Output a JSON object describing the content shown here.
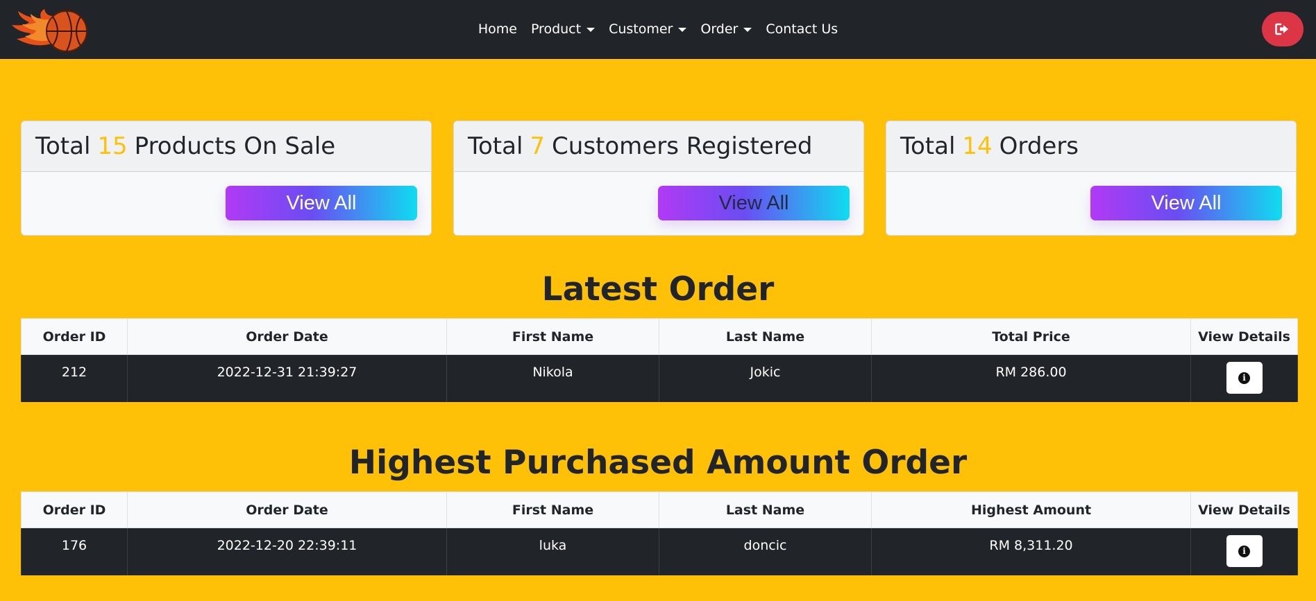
{
  "nav": {
    "items": [
      {
        "label": "Home",
        "dropdown": false
      },
      {
        "label": "Product",
        "dropdown": true
      },
      {
        "label": "Customer",
        "dropdown": true
      },
      {
        "label": "Order",
        "dropdown": true
      },
      {
        "label": "Contact Us",
        "dropdown": false
      }
    ],
    "logout_icon": "sign-out-icon"
  },
  "cards": [
    {
      "prefix": "Total",
      "count": "15",
      "suffix": "Products On Sale",
      "button": "View All"
    },
    {
      "prefix": "Total",
      "count": "7",
      "suffix": "Customers Registered",
      "button": "View All"
    },
    {
      "prefix": "Total",
      "count": "14",
      "suffix": "Orders",
      "button": "View All"
    }
  ],
  "latest": {
    "title": "Latest Order",
    "headers": [
      "Order ID",
      "Order Date",
      "First Name",
      "Last Name",
      "Total Price",
      "View Details"
    ],
    "row": {
      "id": "212",
      "date": "2022-12-31 21:39:27",
      "first": "Nikola",
      "last": "Jokic",
      "amount": "RM 286.00"
    }
  },
  "highest": {
    "title": "Highest Purchased Amount Order",
    "headers": [
      "Order ID",
      "Order Date",
      "First Name",
      "Last Name",
      "Highest Amount",
      "View Details"
    ],
    "row": {
      "id": "176",
      "date": "2022-12-20 22:39:11",
      "first": "luka",
      "last": "doncic",
      "amount": "RM 8,311.20"
    }
  },
  "colors": {
    "page_bg": "#ffc107",
    "navbar": "#212529",
    "logout": "#dc3545",
    "count_highlight": "#ffc107",
    "button_gradient": [
      "#b13af5",
      "#6a4df2",
      "#0fdcf0"
    ]
  }
}
